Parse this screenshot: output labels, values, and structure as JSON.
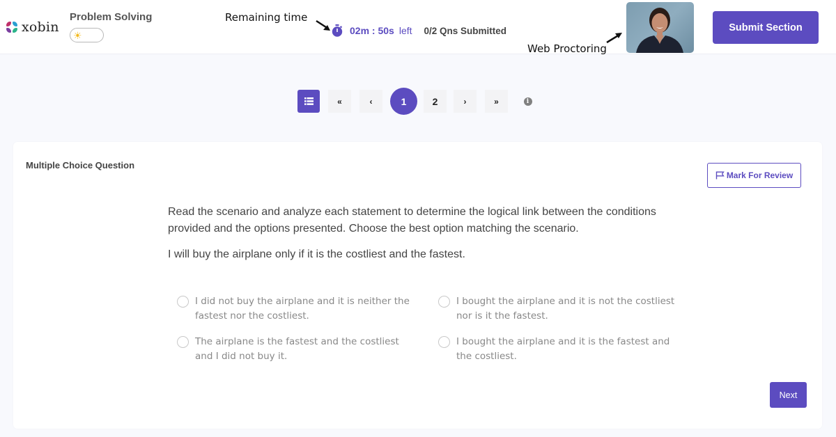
{
  "header": {
    "logo_text": "xobin",
    "section_title": "Problem Solving",
    "theme_toggle_icon": "sun-icon",
    "annotations": {
      "remaining_time": "Remaining time",
      "web_proctoring": "Web Proctoring"
    },
    "timer": {
      "icon": "stopwatch-icon",
      "value": "02m : 50s",
      "suffix": "left"
    },
    "submitted_status": "0/2 Qns Submitted",
    "webcam_alt": "Web proctoring camera feed",
    "submit_button": "Submit Section"
  },
  "pagination": {
    "list_icon": "list-icon",
    "first": "«",
    "prev": "‹",
    "pages": [
      "1",
      "2"
    ],
    "current_page": "1",
    "next": "›",
    "last": "»",
    "info_icon": "info-icon",
    "info_glyph": "i"
  },
  "question": {
    "type_label": "Multiple Choice Question",
    "mark_for_review": "Mark For Review",
    "instructions": "Read the scenario and analyze each statement to determine the logical link between the conditions provided and the options presented. Choose the best option matching the scenario.",
    "statement": "I will buy the airplane only if it is the costliest and the fastest.",
    "options": [
      {
        "label": "I did not buy the airplane and it is neither the fastest nor the costliest.",
        "selected": false
      },
      {
        "label": "I bought the airplane and it is not the costliest nor is it the fastest.",
        "selected": false
      },
      {
        "label": "The airplane is the fastest and the costliest and I did not buy it.",
        "selected": false
      },
      {
        "label": "I bought the airplane and it is the fastest and the costliest.",
        "selected": false
      }
    ],
    "next_button": "Next"
  },
  "colors": {
    "accent": "#5c4cc0",
    "background": "#f8f9fd",
    "option_text": "#888888"
  }
}
